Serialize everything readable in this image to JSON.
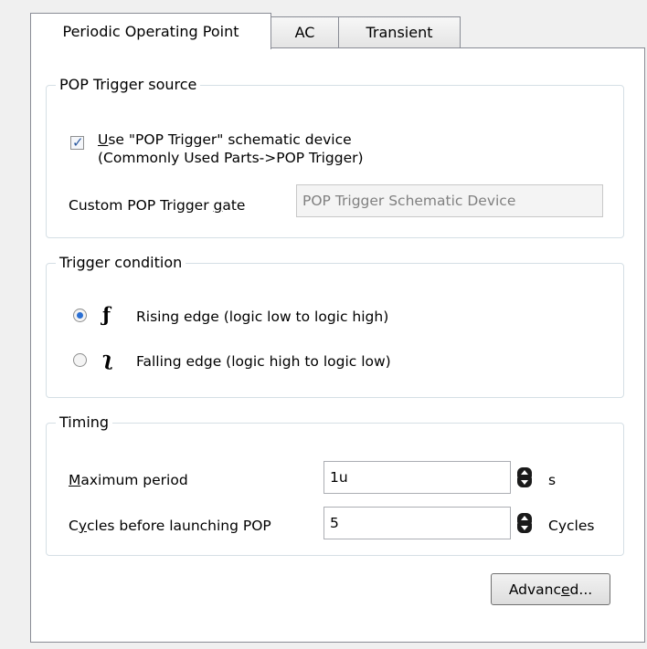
{
  "tabs": [
    {
      "label": "Periodic Operating Point",
      "active": true
    },
    {
      "label": "AC",
      "active": false
    },
    {
      "label": "Transient",
      "active": false
    }
  ],
  "pop_source": {
    "legend": "POP Trigger source",
    "checkbox_checked": true,
    "checkbox_line1_key": "U",
    "checkbox_line1_rest": "se \"POP Trigger\" schematic device",
    "checkbox_line2": "(Commonly Used Parts->POP Trigger)",
    "gate_label_pre": "Custom POP Trigger ",
    "gate_label_key": "g",
    "gate_label_post": "ate",
    "gate_value": "POP Trigger Schematic Device"
  },
  "trigger": {
    "legend": "Trigger condition",
    "rising_label": "Rising edge (logic low to logic high)",
    "falling_label": "Falling edge (logic high to logic low)",
    "selected": "rising"
  },
  "timing": {
    "legend": "Timing",
    "max_period_key": "M",
    "max_period_rest": "aximum period",
    "max_period_value": "1u",
    "max_period_unit": "s",
    "cycles_pre": "C",
    "cycles_key": "y",
    "cycles_post": "cles before launching POP",
    "cycles_value": "5",
    "cycles_unit": "Cycles"
  },
  "advanced_pre": "Advanc",
  "advanced_key": "e",
  "advanced_post": "d..."
}
